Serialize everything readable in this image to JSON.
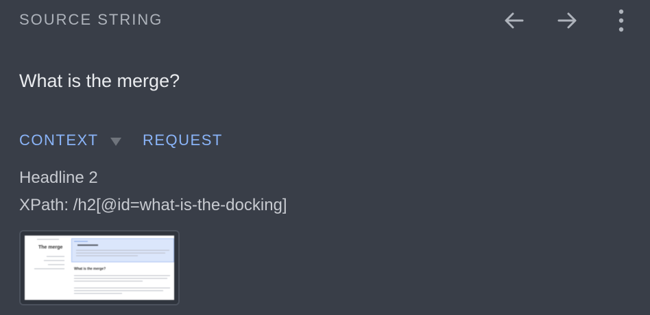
{
  "header": {
    "title": "SOURCE STRING",
    "prev_icon": "arrow-left-icon",
    "next_icon": "arrow-right-icon",
    "more_icon": "more-vertical-icon"
  },
  "source": {
    "text": "What is the merge?"
  },
  "tabs": [
    {
      "label": "CONTEXT",
      "icon": "chevron-down-icon"
    },
    {
      "label": "REQUEST"
    }
  ],
  "context": {
    "element_type": "Headline 2",
    "xpath": "XPath: /h2[@id=what-is-the-docking]"
  },
  "thumbnail": {
    "heading": "The merge",
    "section_heading": "What is the merge?"
  },
  "colors": {
    "background": "#393e48",
    "accent": "#8ab4f8",
    "muted_text": "#aeb3bb",
    "primary_text": "#e9ebee"
  }
}
